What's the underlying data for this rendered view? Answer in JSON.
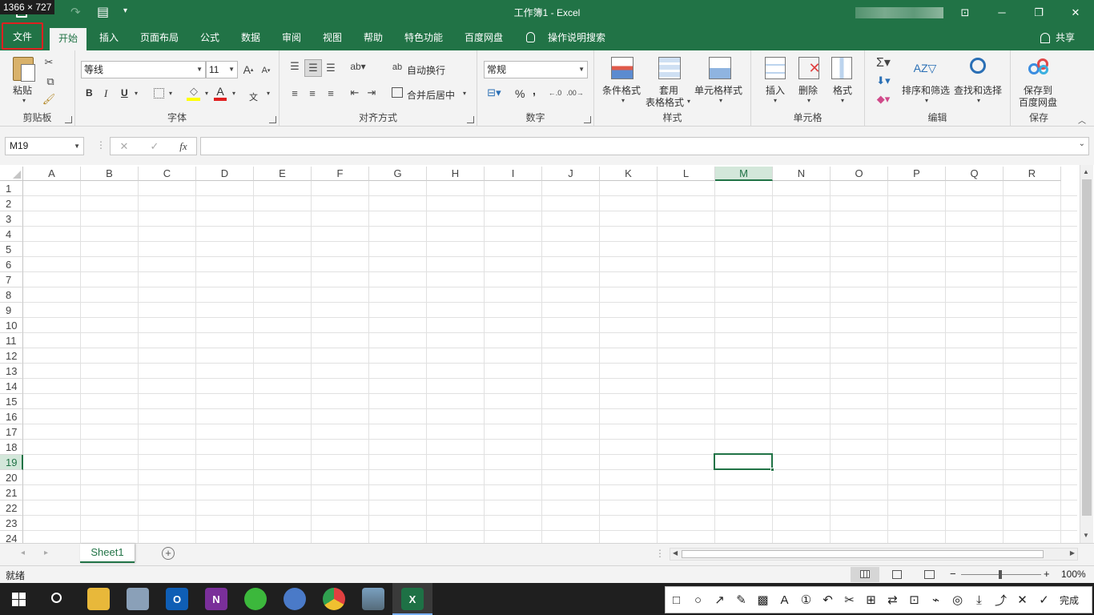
{
  "screen_badge": "1366 × 727",
  "window": {
    "title": "工作簿1 - Excel",
    "minimize_glyph": "─",
    "restore_glyph": "❐",
    "close_glyph": "✕",
    "ribbon_display_glyph": "⊡"
  },
  "qat": {
    "undo_glyph": "↶",
    "redo_glyph": "↷",
    "form_glyph": "▤",
    "customize_glyph": "▾"
  },
  "tabs": [
    {
      "label": "文件"
    },
    {
      "label": "开始"
    },
    {
      "label": "插入"
    },
    {
      "label": "页面布局"
    },
    {
      "label": "公式"
    },
    {
      "label": "数据"
    },
    {
      "label": "审阅"
    },
    {
      "label": "视图"
    },
    {
      "label": "帮助"
    },
    {
      "label": "特色功能"
    },
    {
      "label": "百度网盘"
    },
    {
      "label": "操作说明搜索"
    }
  ],
  "share_label": "共享",
  "ribbon": {
    "clipboard": {
      "paste": "粘贴",
      "label": "剪贴板"
    },
    "font": {
      "name": "等线",
      "size": "11",
      "bold": "B",
      "italic": "I",
      "underline": "U",
      "label": "字体",
      "phonetic": "文"
    },
    "alignment": {
      "wrap": "自动换行",
      "merge": "合并后居中",
      "label": "对齐方式"
    },
    "number": {
      "format": "常规",
      "percent": "%",
      "comma": ",",
      "label": "数字"
    },
    "styles": {
      "conditional": "条件格式",
      "table_line1": "套用",
      "table_line2": "表格格式",
      "cell_styles": "单元格样式",
      "label": "样式"
    },
    "cells": {
      "insert": "插入",
      "delete": "删除",
      "format": "格式",
      "label": "单元格"
    },
    "editing": {
      "sort": "排序和筛选",
      "find": "查找和选择",
      "label": "编辑"
    },
    "save": {
      "line1": "保存到",
      "line2": "百度网盘",
      "label": "保存"
    }
  },
  "formula_bar": {
    "name_box": "M19",
    "fx": "fx",
    "cancel": "✕",
    "enter": "✓",
    "value": ""
  },
  "sheet": {
    "columns": [
      "A",
      "B",
      "C",
      "D",
      "E",
      "F",
      "G",
      "H",
      "I",
      "J",
      "K",
      "L",
      "M",
      "N",
      "O",
      "P",
      "Q",
      "R"
    ],
    "rows": [
      "1",
      "2",
      "3",
      "4",
      "5",
      "6",
      "7",
      "8",
      "9",
      "10",
      "11",
      "12",
      "13",
      "14",
      "15",
      "16",
      "17",
      "18",
      "19",
      "20",
      "21",
      "22",
      "23",
      "24"
    ],
    "selected_column": "M",
    "selected_row": "19",
    "tab_name": "Sheet1",
    "add_sheet": "+"
  },
  "status": {
    "ready": "就绪",
    "zoom": "100%",
    "zoom_minus": "−",
    "zoom_plus": "+"
  },
  "snip_toolbar": {
    "done": "完成"
  },
  "colors": {
    "excel_green": "#217346",
    "ribbon_bg": "#f3f3f3",
    "file_highlight": "#e02020"
  }
}
